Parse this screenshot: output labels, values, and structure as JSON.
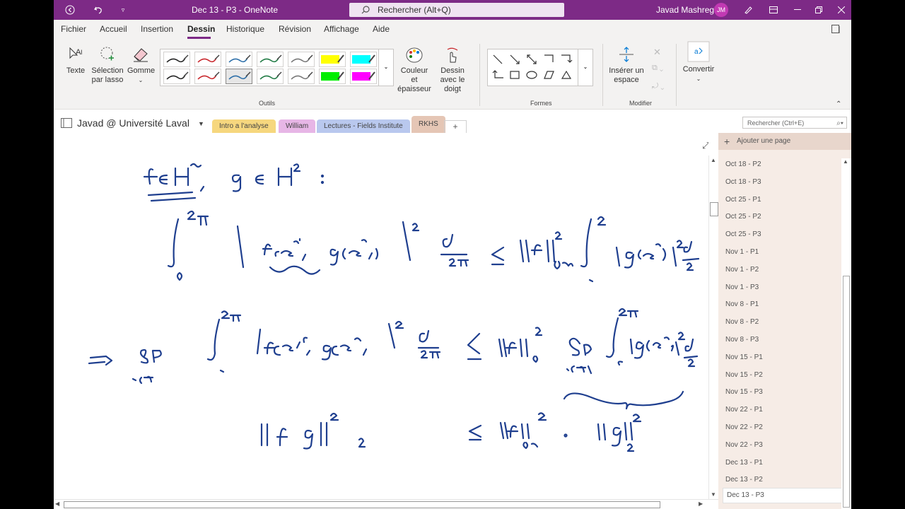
{
  "titlebar": {
    "document_title": "Dec 13 - P3  -  OneNote",
    "search_placeholder": "Rechercher (Alt+Q)",
    "user_name": "Javad Mashreghi",
    "user_initials": "JM",
    "accent": "#7d2a86"
  },
  "menu": {
    "tabs": [
      "Fichier",
      "Accueil",
      "Insertion",
      "Dessin",
      "Historique",
      "Révision",
      "Affichage",
      "Aide"
    ],
    "active": "Dessin"
  },
  "ribbon": {
    "texte": "Texte",
    "selection": "Sélection par lasso",
    "gomme": "Gomme",
    "couleur": "Couleur et épaisseur",
    "dessin_doigt": "Dessin avec le doigt",
    "inserer_espace": "Insérer un espace",
    "convertir": "Convertir",
    "groups": {
      "outils": "Outils",
      "formes": "Formes",
      "modifier": "Modifier"
    },
    "pen_colors": [
      "#222222",
      "#c8262b",
      "#2b6ea8",
      "#1f7a43",
      "#777777",
      "#ffff00",
      "#00ffff",
      "#222222",
      "#c8262b",
      "#2b6ea8",
      "#1f7a43",
      "#777777",
      "#00ee00",
      "#ff00ff"
    ]
  },
  "notebook": {
    "name": "Javad @ Université Laval",
    "sections": [
      {
        "label": "Intro a l'analyse",
        "color": "#f6d77e"
      },
      {
        "label": "William",
        "color": "#e7b6e6"
      },
      {
        "label": "Lectures - Fields Institute",
        "color": "#b9c8ee"
      },
      {
        "label": "RKHS",
        "color": "#e5c6b5"
      }
    ],
    "add_section": "+",
    "page_search_placeholder": "Rechercher (Ctrl+E)"
  },
  "pages": {
    "add_page": "Ajouter une page",
    "items": [
      "Oct 18 - P2",
      "Oct 18 - P3",
      "Oct 25 - P1",
      "Oct 25 - P2",
      "Oct 25 - P3",
      "Nov 1 - P1",
      "Nov 1 - P2",
      "Nov 1 - P3",
      "Nov 8 - P1",
      "Nov 8 - P2",
      "Nov 8 - P3",
      "Nov 15 - P1",
      "Nov 15 - P2",
      "Nov 15 - P3",
      "Nov 22 - P1",
      "Nov 22 - P2",
      "Nov 22 - P3",
      "Dec 13 - P1",
      "Dec 13 - P2",
      "Dec 13 - P3"
    ],
    "selected": "Dec 13 - P3"
  },
  "ink_color": "#1f3f8f"
}
